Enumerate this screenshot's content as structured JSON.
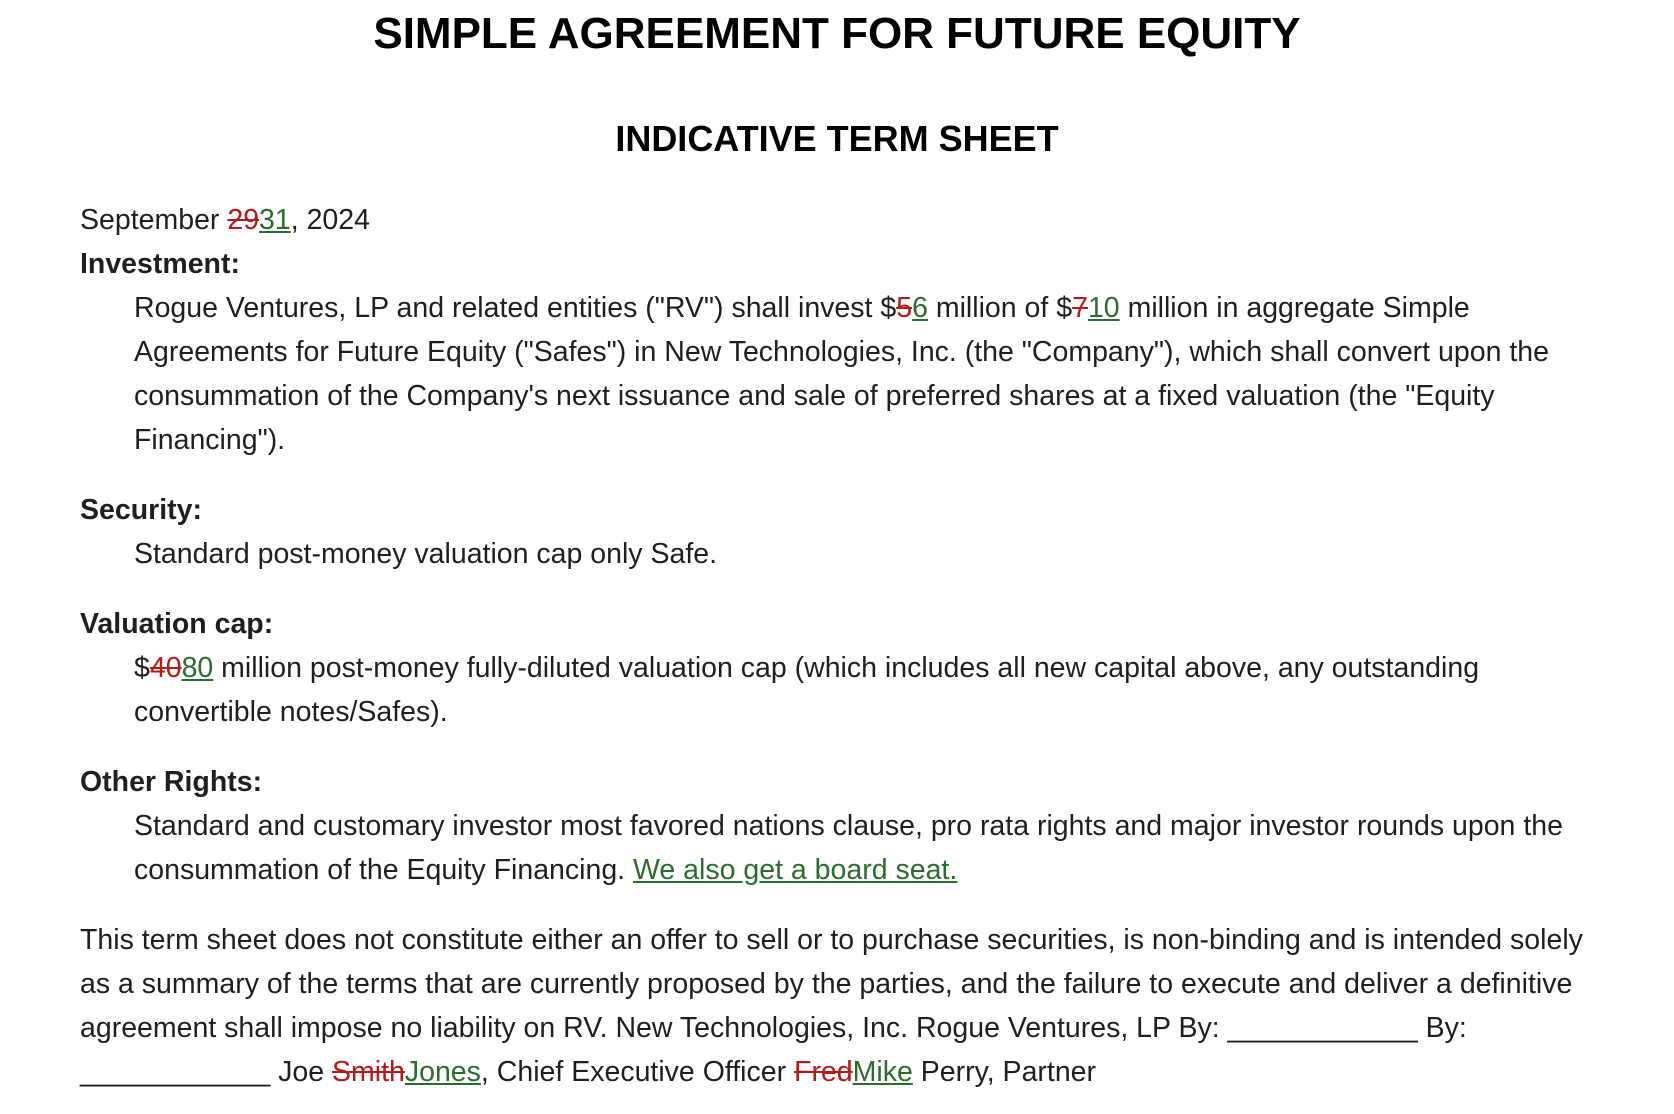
{
  "title": "SIMPLE AGREEMENT FOR FUTURE EQUITY",
  "subtitle": "INDICATIVE TERM SHEET",
  "colors": {
    "deletion": "#b01c1c",
    "insertion": "#2e6b2e",
    "text": "#1f1f1f"
  },
  "date": {
    "month": "September ",
    "day_old": "29",
    "day_new": "31",
    "year": ", 2024"
  },
  "investment": {
    "label": "Investment:",
    "t1": "Rogue Ventures, LP and related entities (\"RV\") shall invest $",
    "amount_old": "5",
    "amount_new": "6",
    "t2": " million of $",
    "aggregate_old": "7",
    "aggregate_new": "10",
    "t3": " million in aggregate Simple Agreements for Future Equity (\"Safes\") in New Technologies, Inc. (the \"Company\"), which shall convert upon the consummation of the Company's next issuance and sale of preferred shares at a fixed valuation (the \"Equity Financing\")."
  },
  "security": {
    "label": "Security:",
    "text": "Standard post-money valuation cap only Safe."
  },
  "valuation_cap": {
    "label": "Valuation cap:",
    "t1": "$",
    "cap_old": "40",
    "cap_new": "80",
    "t2": " million post-money fully-diluted valuation cap (which includes all new capital above, any outstanding convertible notes/Safes)."
  },
  "other_rights": {
    "label": "Other Rights:",
    "text": "Standard and customary investor most favored nations clause, pro rata rights and major investor rounds upon the consummation of the Equity Financing. ",
    "added_text": "We also get a board seat."
  },
  "disclaimer": {
    "t1": "This term sheet does not constitute either an offer to sell or to purchase securities, is non-binding and is intended solely as a summary of the terms that are currently proposed by the parties, and the failure to execute and deliver a definitive agreement shall impose no liability on RV. New Technologies, Inc. Rogue Ventures, LP By: ____________ By: ____________ Joe ",
    "ceo_surname_old": "Smith",
    "ceo_surname_new": "Jones",
    "t2": ", Chief Executive Officer ",
    "partner_first_old": "Fred",
    "partner_first_new": "Mike",
    "t3": " Perry, Partner"
  }
}
